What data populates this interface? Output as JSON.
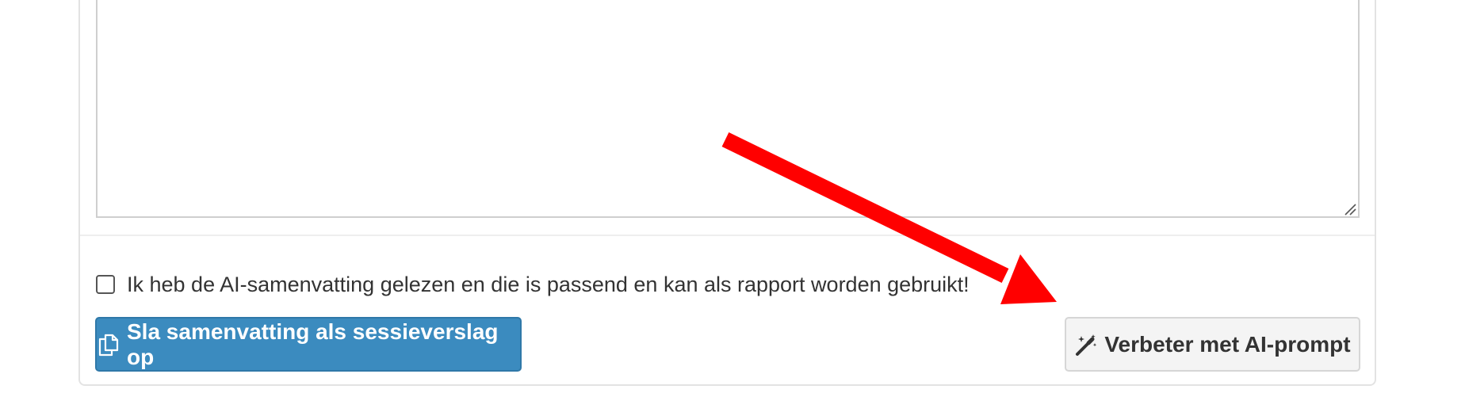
{
  "form": {
    "summary_textarea_value": "",
    "confirm_checkbox": {
      "label": "Ik heb de AI-samenvatting gelezen en die is passend en kan als rapport worden gebruikt!",
      "checked": false
    },
    "save_button": {
      "label": "Sla samenvatting als sessieverslag op",
      "icon": "copy-icon",
      "color": "#3b8bbf"
    },
    "improve_button": {
      "label": "Verbeter met AI-prompt",
      "icon": "magic-wand-icon"
    }
  },
  "annotation": {
    "arrow_color": "#ff0000",
    "arrow_target": "improve-button"
  }
}
